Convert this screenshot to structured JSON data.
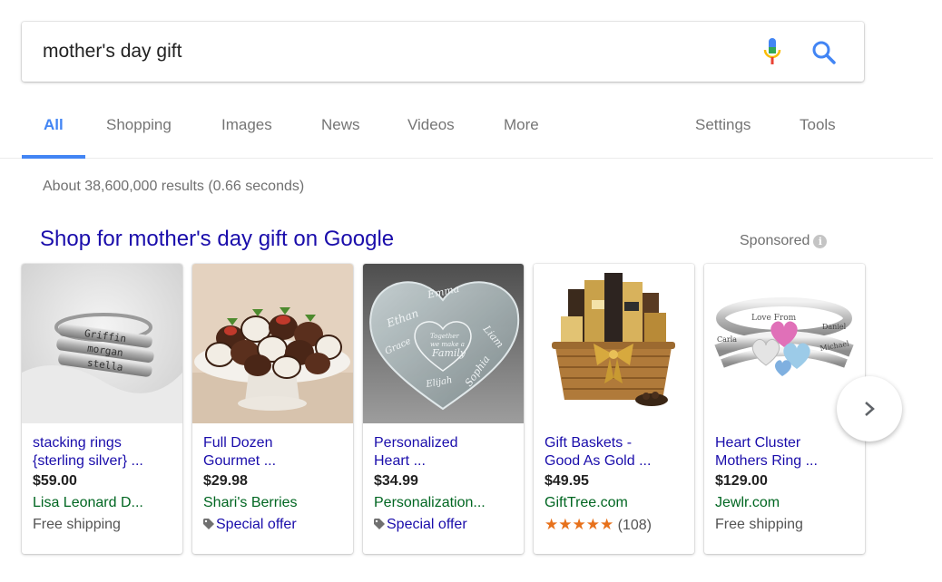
{
  "search": {
    "query": "mother's day gift",
    "mic_icon": "microphone-icon",
    "search_icon": "magnifier-icon"
  },
  "tabs": {
    "items": [
      "All",
      "Shopping",
      "Images",
      "News",
      "Videos",
      "More"
    ],
    "right": [
      "Settings",
      "Tools"
    ],
    "active": "All"
  },
  "stats": "About 38,600,000 results (0.66 seconds)",
  "shopping": {
    "title": "Shop for mother's day gift on Google",
    "sponsored": "Sponsored",
    "info_icon": "info-icon"
  },
  "cards": [
    {
      "title": "stacking rings\n{sterling silver} ...",
      "price": "$59.00",
      "merchant": "Lisa Leonard D...",
      "extra": "Free shipping"
    },
    {
      "title": "Full Dozen\nGourmet ...",
      "price": "$29.98",
      "merchant": "Shari's Berries",
      "offer": "Special offer"
    },
    {
      "title": "Personalized\nHeart ...",
      "price": "$34.99",
      "merchant": "Personalization...",
      "offer": "Special offer"
    },
    {
      "title": "Gift Baskets -\nGood As Gold ...",
      "price": "$49.95",
      "merchant": "GiftTree.com",
      "stars": "★★★★★",
      "rating_value": 5,
      "rating_count": "(108)"
    },
    {
      "title": "Heart Cluster\nMothers Ring ...",
      "price": "$129.00",
      "merchant": "Jewlr.com",
      "extra": "Free shipping"
    }
  ],
  "image_text": {
    "ring1": [
      "Griffin",
      "morgan",
      "stella"
    ],
    "heart": [
      "Emma",
      "Liam",
      "Ethan",
      "Grace",
      "Elijah",
      "Sophia",
      "Together",
      "we make a",
      "Family"
    ],
    "ring2": [
      "Love From",
      "Daniel",
      "Carla",
      "Michael"
    ]
  },
  "colors": {
    "accent_blue": "#4285f4",
    "link": "#1a0dab",
    "merchant_green": "#006621",
    "star_orange": "#e7711b"
  },
  "next_button_icon": "chevron-right-icon"
}
